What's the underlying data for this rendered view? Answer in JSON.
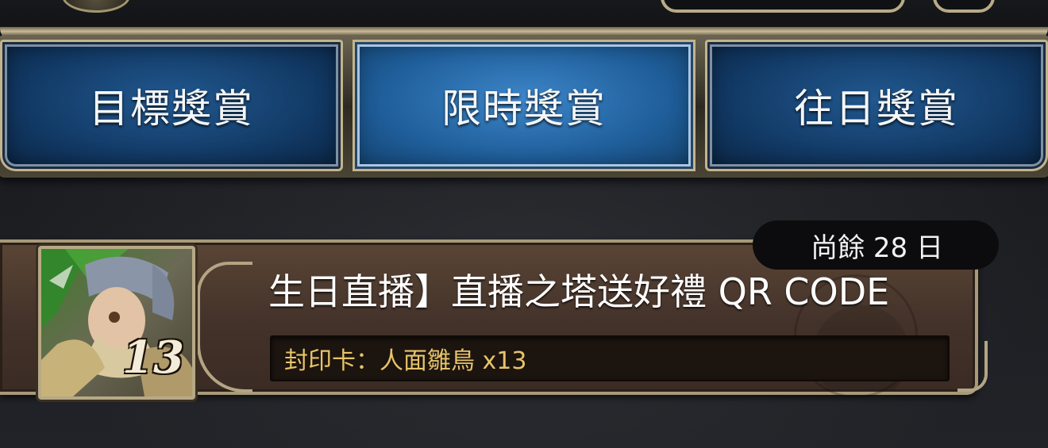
{
  "tabs": [
    {
      "label": "目標獎賞",
      "active": false
    },
    {
      "label": "限時獎賞",
      "active": true
    },
    {
      "label": "往日獎賞",
      "active": false
    }
  ],
  "reward_card": {
    "remaining": "尚餘 28 日",
    "title": "生日直播】直播之塔送好禮 QR CODE",
    "reward": "封印卡：人面雛鳥 x13",
    "portrait_level": "13",
    "portrait_icon": "harpy-chick-card-icon"
  },
  "colors": {
    "tab_blue": "#123a66",
    "tab_active_blue": "#1f5e9a",
    "gold_frame": "#b7a986",
    "reward_text": "#e6c46a",
    "card_brown": "#43322a"
  }
}
